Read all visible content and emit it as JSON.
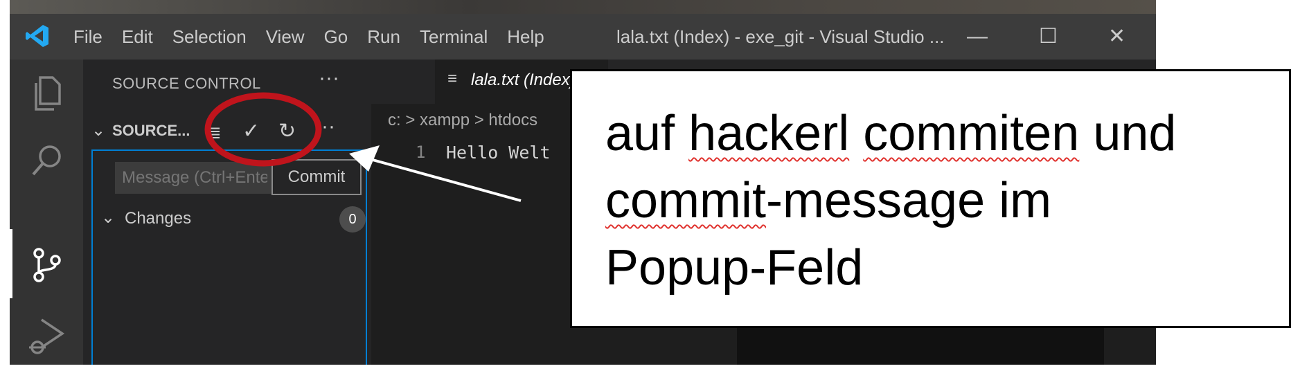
{
  "window": {
    "title": "lala.txt (Index) - exe_git - Visual Studio ...",
    "controls": {
      "minimize": "—",
      "maximize": "☐",
      "close": "✕"
    }
  },
  "menu": [
    "File",
    "Edit",
    "Selection",
    "View",
    "Go",
    "Run",
    "Terminal",
    "Help"
  ],
  "activity_bar": {
    "items": [
      {
        "name": "explorer",
        "icon": "files-icon"
      },
      {
        "name": "search",
        "icon": "search-icon"
      },
      {
        "name": "source-control",
        "icon": "source-control-icon",
        "active": true
      },
      {
        "name": "run-debug",
        "icon": "run-debug-icon"
      }
    ]
  },
  "sidebar": {
    "title": "SOURCE CONTROL",
    "more": "···",
    "section": {
      "name": "SOURCE...",
      "actions": [
        "view-as-list-icon",
        "commit-check-icon",
        "refresh-icon",
        "more-icon"
      ],
      "more": "···"
    },
    "message_placeholder": "Message (Ctrl+Enter to commit)",
    "commit_tooltip": "Commit",
    "changes": {
      "label": "Changes",
      "count": "0"
    }
  },
  "editor": {
    "tab_label": "lala.txt (Index)",
    "breadcrumb": "c: > xampp > htdocs",
    "line_number": "1",
    "code_line": "Hello Welt"
  },
  "annotation": {
    "line1_a": "auf ",
    "line1_b": "hackerl",
    "line1_c": " ",
    "line1_d": "commiten",
    "line1_e": " und",
    "line2_a": "commit",
    "line2_b": "-message im",
    "line3": "Popup-Feld"
  },
  "colors": {
    "accent": "#007fd4",
    "highlight_circle": "#c0141c",
    "vscode_blue": "#23a9f2"
  }
}
